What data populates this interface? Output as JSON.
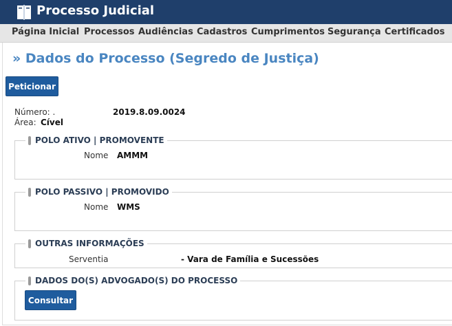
{
  "app": {
    "title": "Processo Judicial",
    "logo_icon": "book-icon"
  },
  "menu": [
    "Página Inicial",
    "Processos",
    "Audiências",
    "Cadastros",
    "Cumprimentos",
    "Segurança",
    "Certificados"
  ],
  "page": {
    "title": "» Dados do Processo (Segredo de Justiça)",
    "peticionar_label": "Peticionar"
  },
  "processo": {
    "numero_label": "Número: .",
    "numero_value": "2019.8.09.0024",
    "area_label": "Área:",
    "area_value": "Cível"
  },
  "polo_ativo": {
    "legend": "POLO ATIVO | PROMOVENTE",
    "nome_label": "Nome",
    "nome_value": "AMMM"
  },
  "polo_passivo": {
    "legend": "POLO PASSIVO | PROMOVIDO",
    "nome_label": "Nome",
    "nome_value": "WMS"
  },
  "outras": {
    "legend": "OUTRAS INFORMAÇÕES",
    "serventia_label": "Serventia",
    "serventia_value": "- Vara de Família e Sucessões"
  },
  "advogados": {
    "legend": "DADOS DO(S) ADVOGADO(S) DO PROCESSO",
    "consultar_label": "Consultar"
  },
  "colors": {
    "header_bg": "#1f3f6b",
    "title": "#4a86c1",
    "button": "#1f5c9e"
  }
}
